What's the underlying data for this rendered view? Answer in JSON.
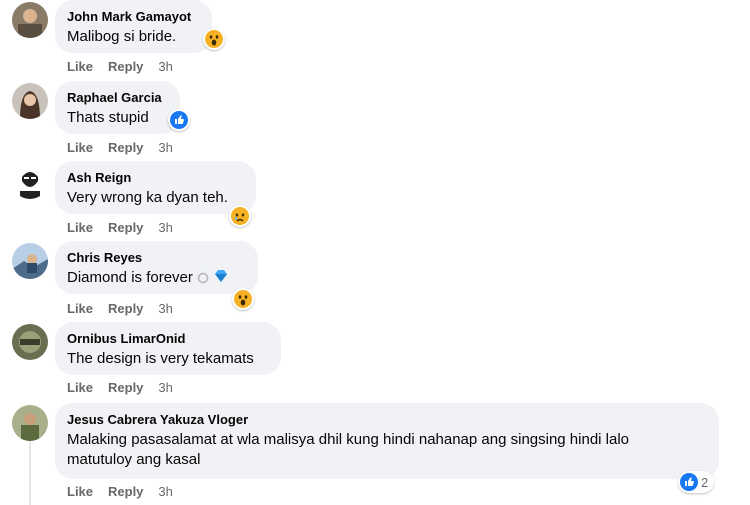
{
  "comments": [
    {
      "name": "John Mark Gamayot",
      "text": "Malibog si bride.",
      "reaction": "wow",
      "actions": {
        "like": "Like",
        "reply": "Reply",
        "time": "3h"
      }
    },
    {
      "name": "Raphael Garcia",
      "text": "Thats stupid",
      "reaction": "like",
      "actions": {
        "like": "Like",
        "reply": "Reply",
        "time": "3h"
      }
    },
    {
      "name": "Ash Reign",
      "text": "Very wrong ka dyan teh.",
      "reaction": "sad",
      "actions": {
        "like": "Like",
        "reply": "Reply",
        "time": "3h"
      }
    },
    {
      "name": "Chris Reyes",
      "text": "Diamond is forever",
      "reaction": "wow",
      "emoji": [
        "ring-icon",
        "gem-icon"
      ],
      "actions": {
        "like": "Like",
        "reply": "Reply",
        "time": "3h"
      }
    },
    {
      "name": "Ornibus LimarOnid",
      "text": "The design is very tekamats",
      "actions": {
        "like": "Like",
        "reply": "Reply",
        "time": "3h"
      }
    },
    {
      "name": "Jesus Cabrera Yakuza Vloger",
      "text": "Malaking pasasalamat at wla malisya dhil kung hindi nahanap ang singsing hindi lalo matutuloy ang kasal",
      "reaction": "like",
      "reaction_count": "2",
      "actions": {
        "like": "Like",
        "reply": "Reply",
        "time": "3h"
      }
    }
  ],
  "colors": {
    "bubble": "#f0f2f5",
    "action_text": "#65676b",
    "like_blue": "#1877f2",
    "wow_yellow": "#f7b125"
  }
}
